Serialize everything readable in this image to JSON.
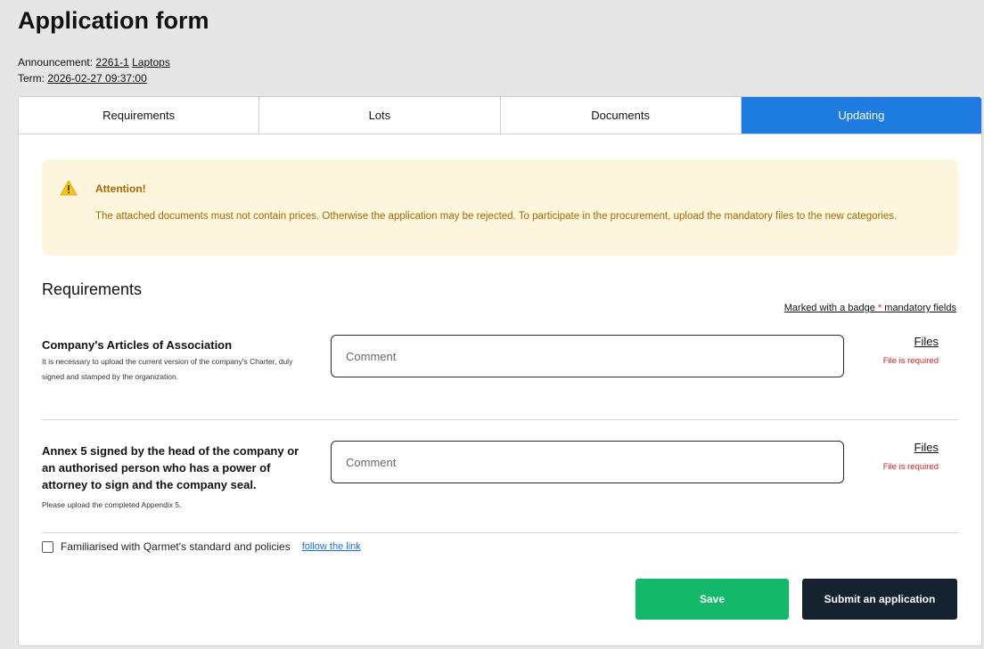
{
  "header": {
    "title": "Application form",
    "announcement_label": "Announcement:",
    "announcement_number": "2261-1",
    "announcement_name": "Laptops",
    "term_label": "Term:",
    "term_value": "2026-02-27 09:37:00"
  },
  "tabs": [
    {
      "label": "Requirements",
      "active": false
    },
    {
      "label": "Lots",
      "active": false
    },
    {
      "label": "Documents",
      "active": false
    },
    {
      "label": "Updating",
      "active": true
    }
  ],
  "alert": {
    "icon": "warning-triangle-icon",
    "title": "Attention!",
    "text": "The attached documents must not contain prices. Otherwise the application may be rejected. To participate in the procurement, upload the mandatory files to the new categories."
  },
  "requirements": {
    "section_title": "Requirements",
    "mandatory_note_prefix": "Marked with a badge",
    "mandatory_star": "*",
    "mandatory_note_suffix": "mandatory fields",
    "items": [
      {
        "title": "Company's Articles of Association",
        "description": "It is necessary to upload the current version of the company's Charter, duly signed and stamped by the organization.",
        "comment_placeholder": "Comment",
        "files_label": "Files",
        "file_status": "File is required"
      },
      {
        "title": "Annex 5 signed by the head of the company or an authorised person who has a power of attorney to sign and the company seal.",
        "description": "Please upload the completed Appendix 5.",
        "comment_placeholder": "Comment",
        "files_label": "Files",
        "file_status": "File is required"
      }
    ]
  },
  "policy": {
    "checked": false,
    "label": "Familiarised with Qarmet's standard and policies",
    "link_text": "follow the link"
  },
  "actions": {
    "save_label": "Save",
    "submit_label": "Submit an application"
  },
  "colors": {
    "active_tab": "#1e7be0",
    "alert_bg": "#fdf6dc",
    "alert_text": "#a26a07",
    "save_button": "#12b96b",
    "submit_button": "#15222f",
    "required_red": "#d42020"
  }
}
